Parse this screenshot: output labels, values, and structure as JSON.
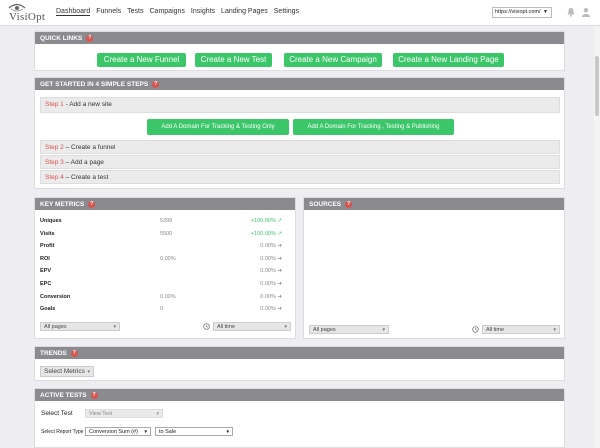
{
  "header": {
    "logo_text": "VisiOpt",
    "nav": [
      "Dashboard",
      "Funnels",
      "Tests",
      "Campaigns",
      "Insights",
      "Landing Pages",
      "Settings"
    ],
    "domain": "https://visiopt.com/"
  },
  "quick_links": {
    "title": "QUICK LINKS",
    "buttons": [
      "Create a New Funnel",
      "Create a New Test",
      "Create a New Campaign",
      "Create a New Landing Page"
    ]
  },
  "get_started": {
    "title": "GET STARTED IN 4 SIMPLE STEPS",
    "steps": [
      {
        "num": "Step 1",
        "sep": " - ",
        "text": "Add a new site"
      },
      {
        "num": "Step 2",
        "sep": " – ",
        "text": "Create a funnel"
      },
      {
        "num": "Step 3",
        "sep": " – ",
        "text": "Add a page"
      },
      {
        "num": "Step 4",
        "sep": " – ",
        "text": "Create a test"
      }
    ],
    "domain_buttons": [
      "Add A Domain For Tracking & Testing Only",
      "Add A Domain For Tracking , Testing & Publishing"
    ]
  },
  "key_metrics": {
    "title": "KEY METRICS",
    "rows": [
      {
        "label": "Uniques",
        "value": "5399",
        "pct": "+100.00%",
        "trend": "up"
      },
      {
        "label": "Visits",
        "value": "5500",
        "pct": "+100.00%",
        "trend": "up"
      },
      {
        "label": "Profit",
        "value": "",
        "pct": "0.00%",
        "trend": "flat"
      },
      {
        "label": "ROI",
        "value": "0.00%",
        "pct": "0.00%",
        "trend": "flat"
      },
      {
        "label": "EPV",
        "value": "",
        "pct": "0.00%",
        "trend": "flat"
      },
      {
        "label": "EPC",
        "value": "",
        "pct": "0.00%",
        "trend": "flat"
      },
      {
        "label": "Conversion",
        "value": "0.00%",
        "pct": "0.00%",
        "trend": "flat"
      },
      {
        "label": "Goals",
        "value": "0",
        "pct": "0.00%",
        "trend": "flat"
      }
    ],
    "pages_select": "All pages",
    "time_select": "All time"
  },
  "sources": {
    "title": "SOURCES",
    "pages_select": "All pages",
    "time_select": "All time"
  },
  "trends": {
    "title": "TRENDS",
    "select_metrics": "Select Metrics"
  },
  "active_tests": {
    "title": "ACTIVE TESTS",
    "select_test_label": "Select Test",
    "select_test_value": "View Test",
    "report_type_label": "Select Report Type",
    "report_type_value": "Conversion Sum (#)",
    "goal_value": "to Sale"
  },
  "colors": {
    "accent_green": "#3cc66a",
    "header_gray": "#8b8b8f",
    "step_red": "#d9534f"
  }
}
